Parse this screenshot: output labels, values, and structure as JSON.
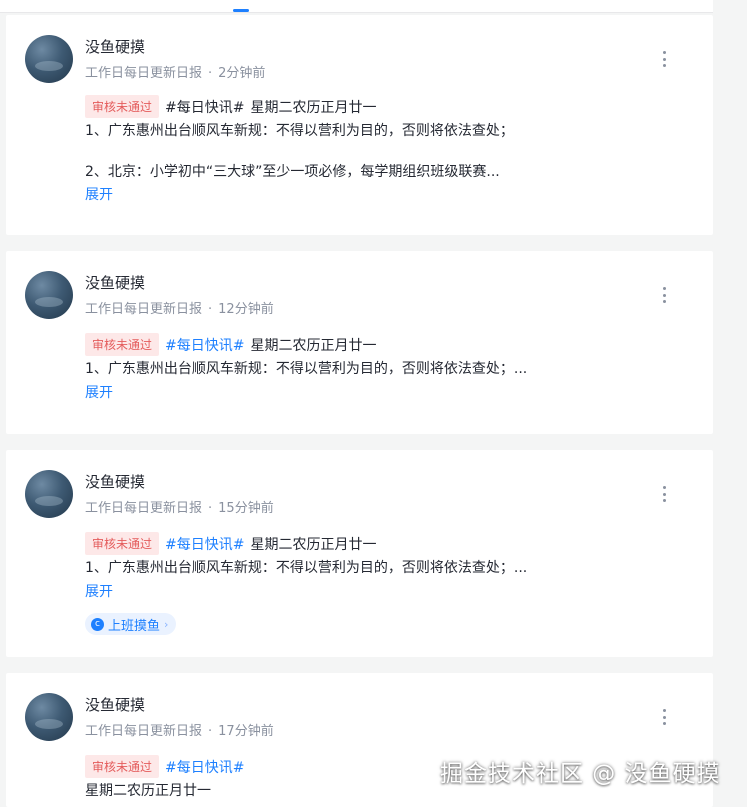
{
  "author_name": "没鱼硬摸",
  "badge_label": "审核未通过",
  "expand_label": "展开",
  "watermark": "掘金技术社区 @ 没鱼硬摸",
  "posts": [
    {
      "group": "工作日每日更新日报",
      "time": "2分钟前",
      "topic": "#每日快讯#",
      "title": "星期二农历正月廿一",
      "line1": "1、广东惠州出台顺风车新规：不得以营利为目的，否则将依法查处；",
      "line2": "2、北京：小学初中“三大球”至少一项必修，每学期组织班级联赛..."
    },
    {
      "group": "工作日每日更新日报",
      "time": "12分钟前",
      "topic": "#每日快讯#",
      "title": "星期二农历正月廿一",
      "line1": "1、广东惠州出台顺风车新规：不得以营利为目的，否则将依法查处；..."
    },
    {
      "group": "工作日每日更新日报",
      "time": "15分钟前",
      "topic": "#每日快讯#",
      "title": "星期二农历正月廿一",
      "line1": "1、广东惠州出台顺风车新规：不得以营利为目的，否则将依法查处；...",
      "circle": "上班摸鱼"
    },
    {
      "group": "工作日每日更新日报",
      "time": "17分钟前",
      "topic": "#每日快讯#",
      "line1": "星期二农历正月廿一"
    }
  ]
}
